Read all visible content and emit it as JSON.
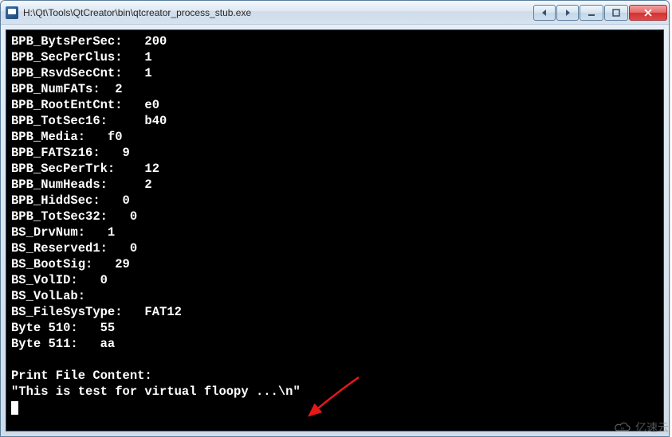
{
  "window": {
    "title": "H:\\Qt\\Tools\\QtCreator\\bin\\qtcreator_process_stub.exe"
  },
  "console": {
    "lines": [
      {
        "label": "BPB_BytsPerSec:",
        "value": "200"
      },
      {
        "label": "BPB_SecPerClus:",
        "value": "1"
      },
      {
        "label": "BPB_RsvdSecCnt:",
        "value": "1"
      },
      {
        "label": "BPB_NumFATs:",
        "value": "2"
      },
      {
        "label": "BPB_RootEntCnt:",
        "value": "e0"
      },
      {
        "label": "BPB_TotSec16:",
        "value": "b40"
      },
      {
        "label": "BPB_Media:",
        "value": "f0"
      },
      {
        "label": "BPB_FATSz16:",
        "value": "9"
      },
      {
        "label": "BPB_SecPerTrk:",
        "value": "12"
      },
      {
        "label": "BPB_NumHeads:",
        "value": "2"
      },
      {
        "label": "BPB_HiddSec:",
        "value": "0"
      },
      {
        "label": "BPB_TotSec32:",
        "value": "0"
      },
      {
        "label": "BS_DrvNum:",
        "value": "1"
      },
      {
        "label": "BS_Reserved1:",
        "value": "0"
      },
      {
        "label": "BS_BootSig:",
        "value": "29"
      },
      {
        "label": "BS_VolID:",
        "value": "0"
      },
      {
        "label": "BS_VolLab:",
        "value": ""
      },
      {
        "label": "BS_FileSysType:",
        "value": "FAT12"
      },
      {
        "label": "Byte 510:",
        "value": "55"
      },
      {
        "label": "Byte 511:",
        "value": "aa"
      }
    ],
    "blank": "",
    "section_header": "Print File Content:",
    "content_line": "\"This is test for virtual floopy ...\\n\""
  },
  "watermark": {
    "text": "亿速云"
  }
}
